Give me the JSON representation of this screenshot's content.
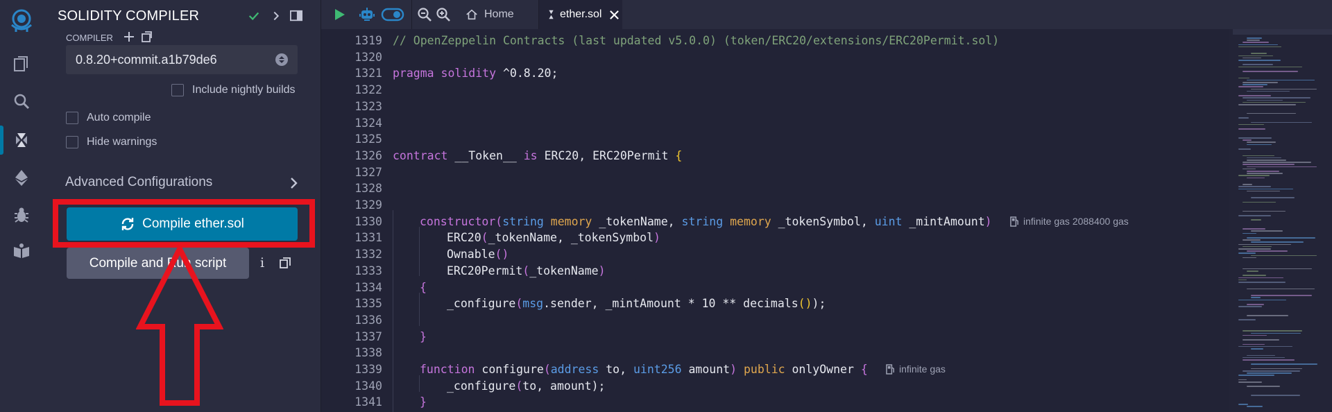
{
  "panel": {
    "title": "SOLIDITY COMPILER",
    "compiler_label": "COMPILER",
    "compiler_version": "0.8.20+commit.a1b79de6",
    "include_nightly_label": "Include nightly builds",
    "auto_compile_label": "Auto compile",
    "hide_warnings_label": "Hide warnings",
    "advanced_label": "Advanced Configurations",
    "compile_button_label": "Compile ether.sol",
    "run_script_label": "Compile and Run script",
    "info_label": "i"
  },
  "tabs": {
    "home_label": "Home",
    "file_label": "ether.sol"
  },
  "editor": {
    "lines": [
      {
        "num": "1319",
        "indent": 0,
        "tokens": [
          {
            "t": "// OpenZeppelin Contracts (last updated v5.0.0) (token/ERC20/extensions/ERC20Permit.sol)",
            "c": "comment"
          }
        ]
      },
      {
        "num": "1320",
        "indent": 0,
        "tokens": []
      },
      {
        "num": "1321",
        "indent": 0,
        "tokens": [
          {
            "t": "pragma solidity ",
            "c": "keyword"
          },
          {
            "t": "^0.8.20;",
            "c": "plain"
          }
        ]
      },
      {
        "num": "1322",
        "indent": 0,
        "tokens": []
      },
      {
        "num": "1323",
        "indent": 0,
        "tokens": []
      },
      {
        "num": "1324",
        "indent": 0,
        "tokens": []
      },
      {
        "num": "1325",
        "indent": 0,
        "tokens": []
      },
      {
        "num": "1326",
        "indent": 0,
        "tokens": [
          {
            "t": "contract ",
            "c": "keyword"
          },
          {
            "t": "__Token__ ",
            "c": "plain"
          },
          {
            "t": "is ",
            "c": "keyword"
          },
          {
            "t": "ERC20, ERC20Permit ",
            "c": "plain"
          },
          {
            "t": "{",
            "c": "bracket"
          }
        ]
      },
      {
        "num": "1327",
        "indent": 0,
        "tokens": []
      },
      {
        "num": "1328",
        "indent": 0,
        "tokens": []
      },
      {
        "num": "1329",
        "indent": 0,
        "tokens": []
      },
      {
        "num": "1330",
        "indent": 1,
        "tokens": [
          {
            "t": "constructor",
            "c": "keyword"
          },
          {
            "t": "(",
            "c": "keyword"
          },
          {
            "t": "string ",
            "c": "type"
          },
          {
            "t": "memory ",
            "c": "storage"
          },
          {
            "t": "_tokenName, ",
            "c": "plain"
          },
          {
            "t": "string ",
            "c": "type"
          },
          {
            "t": "memory ",
            "c": "storage"
          },
          {
            "t": "_tokenSymbol, ",
            "c": "plain"
          },
          {
            "t": "uint ",
            "c": "type"
          },
          {
            "t": "_mintAmount",
            "c": "plain"
          },
          {
            "t": ")",
            "c": "keyword"
          }
        ],
        "gas": "infinite gas 2088400 gas"
      },
      {
        "num": "1331",
        "indent": 2,
        "tokens": [
          {
            "t": "ERC20",
            "c": "plain"
          },
          {
            "t": "(",
            "c": "keyword"
          },
          {
            "t": "_tokenName, _tokenSymbol",
            "c": "plain"
          },
          {
            "t": ")",
            "c": "keyword"
          }
        ]
      },
      {
        "num": "1332",
        "indent": 2,
        "tokens": [
          {
            "t": "Ownable",
            "c": "plain"
          },
          {
            "t": "()",
            "c": "keyword"
          }
        ]
      },
      {
        "num": "1333",
        "indent": 2,
        "tokens": [
          {
            "t": "ERC20Permit",
            "c": "plain"
          },
          {
            "t": "(",
            "c": "keyword"
          },
          {
            "t": "_tokenName",
            "c": "plain"
          },
          {
            "t": ")",
            "c": "keyword"
          }
        ]
      },
      {
        "num": "1334",
        "indent": 1,
        "tokens": [
          {
            "t": "{",
            "c": "keyword"
          }
        ]
      },
      {
        "num": "1335",
        "indent": 2,
        "tokens": [
          {
            "t": "_configure",
            "c": "plain"
          },
          {
            "t": "(",
            "c": "keyword"
          },
          {
            "t": "msg",
            "c": "type"
          },
          {
            "t": ".sender, _mintAmount * 10 ** decimals",
            "c": "plain"
          },
          {
            "t": "()",
            "c": "bracket"
          },
          {
            "t": ");",
            "c": "plain"
          }
        ]
      },
      {
        "num": "1336",
        "indent": 0,
        "tokens": []
      },
      {
        "num": "1337",
        "indent": 1,
        "tokens": [
          {
            "t": "}",
            "c": "keyword"
          }
        ]
      },
      {
        "num": "1338",
        "indent": 0,
        "tokens": []
      },
      {
        "num": "1339",
        "indent": 1,
        "tokens": [
          {
            "t": "function ",
            "c": "keyword"
          },
          {
            "t": "configure",
            "c": "plain"
          },
          {
            "t": "(",
            "c": "keyword"
          },
          {
            "t": "address ",
            "c": "type"
          },
          {
            "t": "to, ",
            "c": "plain"
          },
          {
            "t": "uint256 ",
            "c": "type"
          },
          {
            "t": "amount",
            "c": "plain"
          },
          {
            "t": ") ",
            "c": "keyword"
          },
          {
            "t": "public ",
            "c": "storage"
          },
          {
            "t": "onlyOwner ",
            "c": "plain"
          },
          {
            "t": "{",
            "c": "keyword"
          }
        ],
        "gas": "infinite gas"
      },
      {
        "num": "1340",
        "indent": 2,
        "tokens": [
          {
            "t": "_configure",
            "c": "plain"
          },
          {
            "t": "(",
            "c": "keyword"
          },
          {
            "t": "to, amount",
            "c": "plain"
          },
          {
            "t": ");",
            "c": "plain"
          }
        ]
      },
      {
        "num": "1341",
        "indent": 1,
        "tokens": [
          {
            "t": "}",
            "c": "keyword"
          }
        ]
      }
    ]
  },
  "colors": {
    "accent": "#007aa6",
    "highlight": "#e8131e",
    "check_green": "#3fba73"
  },
  "icons": {
    "rail": [
      "remix-logo-icon",
      "file-explorer-icon",
      "search-icon",
      "solidity-compiler-icon",
      "deploy-icon",
      "debugger-icon",
      "learneth-icon"
    ],
    "tabs": [
      "run-icon",
      "robot-icon",
      "toggle-icon",
      "zoom-out-icon",
      "zoom-in-icon",
      "home-icon",
      "solidity-file-icon",
      "close-icon"
    ]
  }
}
